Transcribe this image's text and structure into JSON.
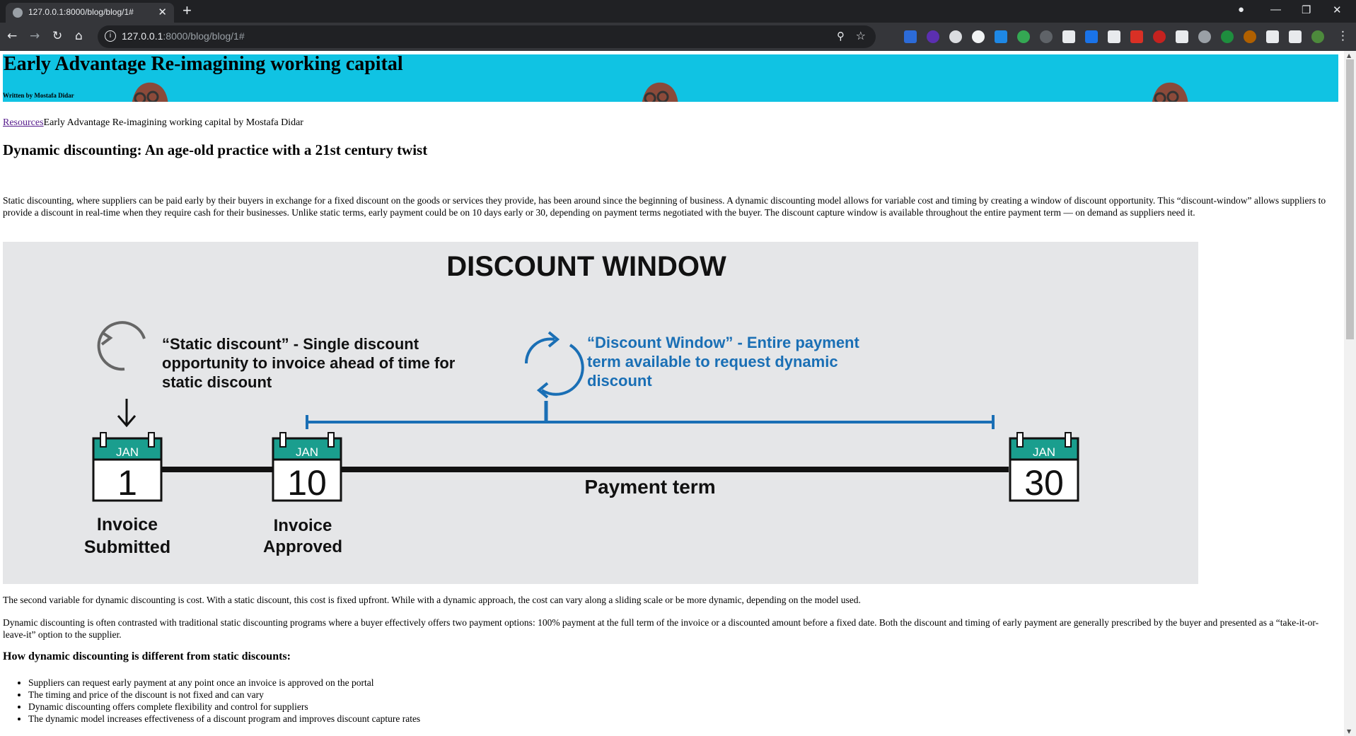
{
  "browser": {
    "tab_title": "127.0.0.1:8000/blog/blog/1#",
    "url_host": "127.0.0.1",
    "url_path": ":8000/blog/blog/1#",
    "icons": [
      "back-icon",
      "forward-icon",
      "reload-icon",
      "home-icon",
      "site-info-icon",
      "zoom-icon",
      "bookmark-star-icon",
      "extensions-icon",
      "profile-avatar",
      "menu-icon"
    ]
  },
  "hero": {
    "title": "Early Advantage Re-imagining working capital",
    "byline": "Written by Mostafa Didar",
    "bg_color": "#10c3e3"
  },
  "breadcrumb": {
    "link": "Resources",
    "text": "Early Advantage Re-imagining working capital by Mostafa Didar"
  },
  "article": {
    "subtitle": "Dynamic discounting: An age-old practice with a 21st century twist",
    "p1": "Static discounting, where suppliers can be paid early by their buyers in exchange for a fixed discount on the goods or services they provide, has been around since the beginning of business. A dynamic discounting model allows for variable cost and timing by creating a window of discount opportunity. This “discount-window” allows suppliers to provide a discount in real-time when they require cash for their businesses. Unlike static terms, early payment could be on 10 days early or 30, depending on payment terms negotiated with the buyer. The discount capture window is available throughout the entire payment term — on demand as suppliers need it.",
    "p2": "The second variable for dynamic discounting is cost. With a static discount, this cost is fixed upfront. While with a dynamic approach, the cost can vary along a sliding scale or be more dynamic, depending on the model used.",
    "p3": "Dynamic discounting is often contrasted with traditional static discounting programs where a buyer effectively offers two payment options: 100% payment at the full term of the invoice or a discounted amount before a fixed date. Both the discount and timing of early payment are generally prescribed by the buyer and presented as a “take-it-or-leave-it” option to the supplier.",
    "h3": "How dynamic discounting is different from static discounts:",
    "bullets": [
      "Suppliers can request early payment at any point once an invoice is approved on the portal",
      "The timing and price of the discount is not fixed and can vary",
      "Dynamic discounting offers complete flexibility and control for suppliers",
      "The dynamic model increases effectiveness of a discount program and improves discount capture rates"
    ]
  },
  "figure": {
    "title": "DISCOUNT WINDOW",
    "static_line1": "“Static discount” - Single discount",
    "static_line2": "opportunity to invoice ahead of time for",
    "static_line3": "static discount",
    "window_line1": "“Discount Window” - Entire payment",
    "window_line2": "term available to request dynamic",
    "window_line3": "discount",
    "month": "JAN",
    "day1": "1",
    "day2": "10",
    "day3": "30",
    "label1a": "Invoice",
    "label1b": "Submitted",
    "label2a": "Invoice",
    "label2b": "Approved",
    "payment_term": "Payment term",
    "blue": "#1a6fb5",
    "teal": "#1a9e8e"
  }
}
